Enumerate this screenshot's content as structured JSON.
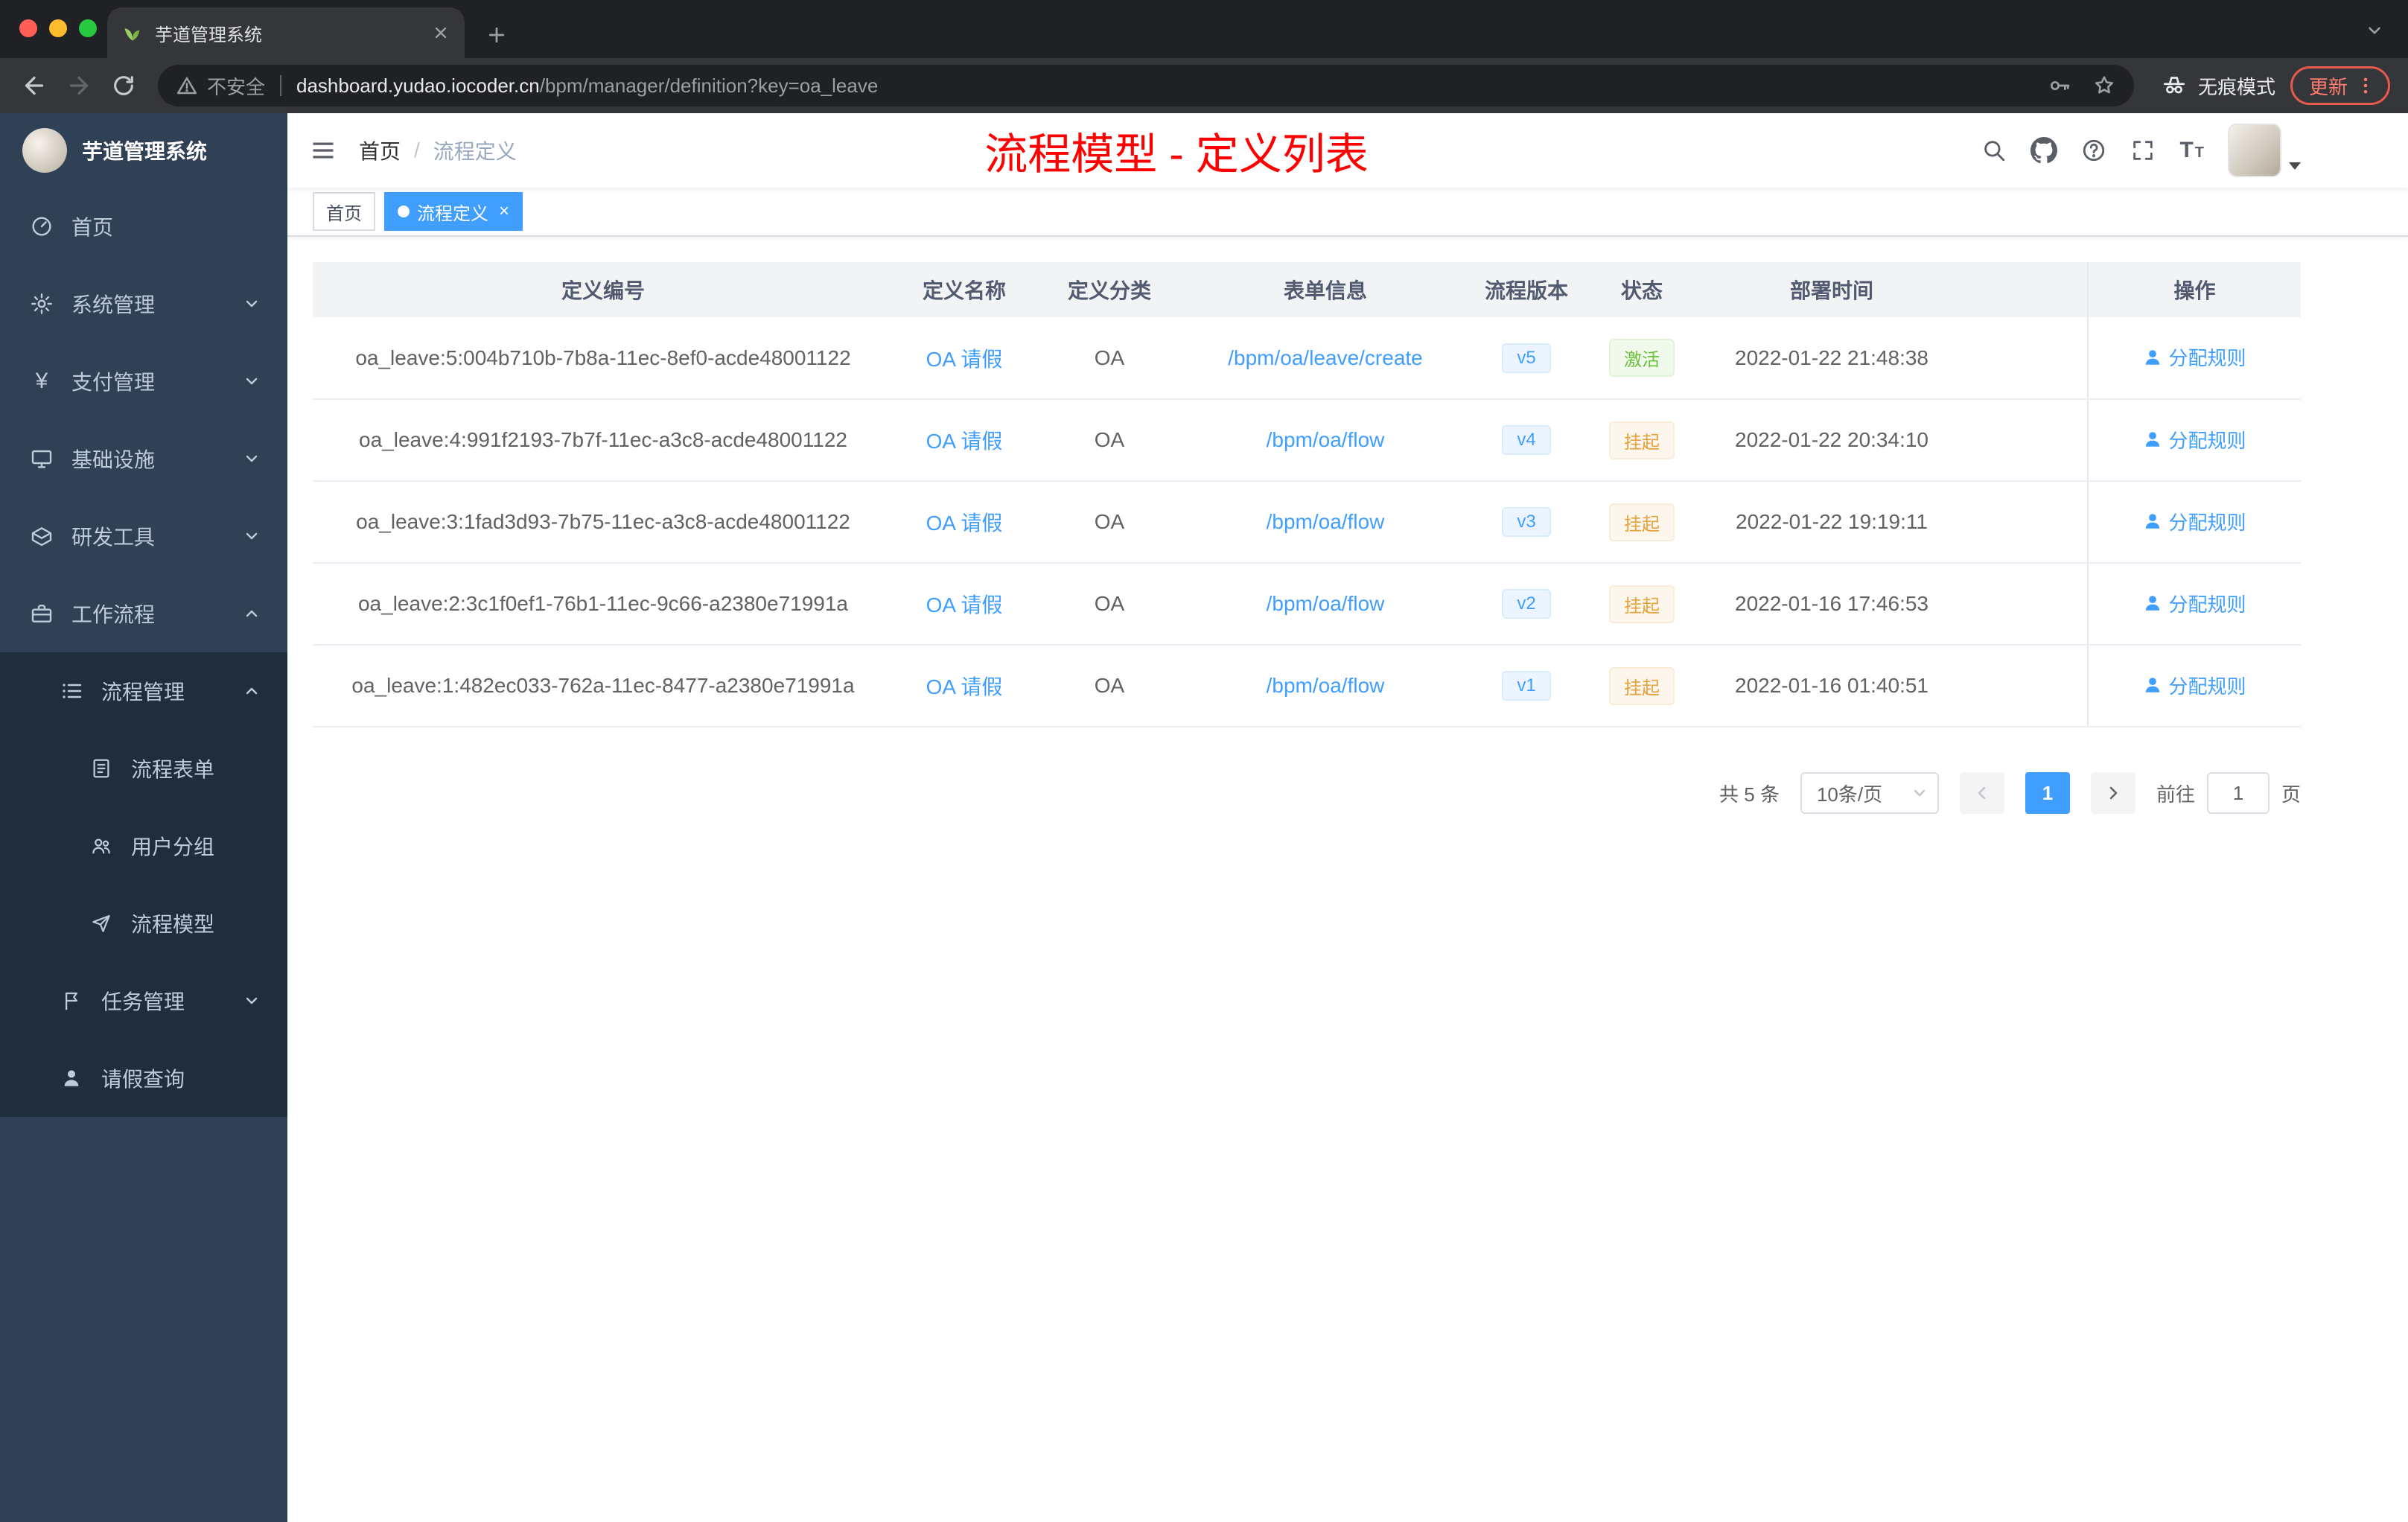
{
  "browser": {
    "tab_title": "芋道管理系统",
    "security_label": "不安全",
    "url_domain": "dashboard.yudao.iocoder.cn",
    "url_path": "/bpm/manager/definition?key=oa_leave",
    "incognito_label": "无痕模式",
    "update_label": "更新"
  },
  "sidebar": {
    "logo_title": "芋道管理系统",
    "items": {
      "home": "首页",
      "system": "系统管理",
      "payment": "支付管理",
      "infra": "基础设施",
      "devtools": "研发工具",
      "workflow": "工作流程",
      "process_mgmt": "流程管理",
      "process_form": "流程表单",
      "user_group": "用户分组",
      "process_model": "流程模型",
      "task_mgmt": "任务管理",
      "leave_query": "请假查询"
    }
  },
  "header": {
    "breadcrumb_home": "首页",
    "breadcrumb_sep": "/",
    "breadcrumb_current": "流程定义",
    "annotation": "流程模型 - 定义列表"
  },
  "tags": {
    "home": "首页",
    "current": "流程定义"
  },
  "table": {
    "columns": [
      "定义编号",
      "定义名称",
      "定义分类",
      "表单信息",
      "流程版本",
      "状态",
      "部署时间",
      "操作"
    ],
    "rows": [
      {
        "id": "oa_leave:5:004b710b-7b8a-11ec-8ef0-acde48001122",
        "name": "OA 请假",
        "category": "OA",
        "form": "/bpm/oa/leave/create",
        "version": "v5",
        "status": "激活",
        "status_type": "success",
        "deploy_time": "2022-01-22 21:48:38",
        "action": "分配规则"
      },
      {
        "id": "oa_leave:4:991f2193-7b7f-11ec-a3c8-acde48001122",
        "name": "OA 请假",
        "category": "OA",
        "form": "/bpm/oa/flow",
        "version": "v4",
        "status": "挂起",
        "status_type": "warning",
        "deploy_time": "2022-01-22 20:34:10",
        "action": "分配规则"
      },
      {
        "id": "oa_leave:3:1fad3d93-7b75-11ec-a3c8-acde48001122",
        "name": "OA 请假",
        "category": "OA",
        "form": "/bpm/oa/flow",
        "version": "v3",
        "status": "挂起",
        "status_type": "warning",
        "deploy_time": "2022-01-22 19:19:11",
        "action": "分配规则"
      },
      {
        "id": "oa_leave:2:3c1f0ef1-76b1-11ec-9c66-a2380e71991a",
        "name": "OA 请假",
        "category": "OA",
        "form": "/bpm/oa/flow",
        "version": "v2",
        "status": "挂起",
        "status_type": "warning",
        "deploy_time": "2022-01-16 17:46:53",
        "action": "分配规则"
      },
      {
        "id": "oa_leave:1:482ec033-762a-11ec-8477-a2380e71991a",
        "name": "OA 请假",
        "category": "OA",
        "form": "/bpm/oa/flow",
        "version": "v1",
        "status": "挂起",
        "status_type": "warning",
        "deploy_time": "2022-01-16 01:40:51",
        "action": "分配规则"
      }
    ]
  },
  "pagination": {
    "total": "共 5 条",
    "page_size": "10条/页",
    "current_page": "1",
    "goto_label": "前往",
    "goto_value": "1",
    "page_unit": "页"
  },
  "colors": {
    "accent": "#409eff",
    "success": "#67c23a",
    "warning": "#e6a23c",
    "annotation": "#ff0000",
    "sidebar_bg": "#304156",
    "submenu_bg": "#1f2d3d"
  }
}
